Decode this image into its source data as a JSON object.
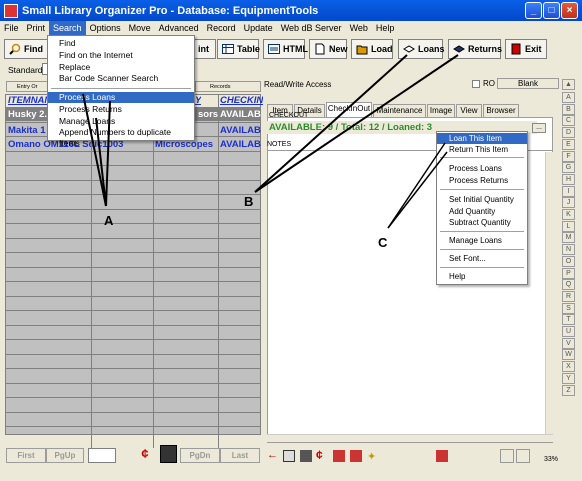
{
  "window": {
    "title": "Small Library Organizer Pro - Database: EquipmentTools"
  },
  "menubar": [
    "File",
    "Print",
    "Search",
    "Options",
    "Move",
    "Advanced",
    "Record",
    "Update",
    "Web dB Server",
    "Web",
    "Help"
  ],
  "toolbar": {
    "find": "Find",
    "print": "int",
    "table": "Table",
    "html": "HTML",
    "new": "New",
    "load": "Load",
    "loans": "Loans",
    "returns": "Returns",
    "exit": "Exit"
  },
  "standard_label": "Standard",
  "entry_order_label": "Entry Or",
  "records_label": "Records",
  "search_menu": {
    "items_group1": [
      "Find",
      "Find on the Internet",
      "Replace",
      "Bar Code Scanner Search"
    ],
    "items_group2": [
      "Process Loans",
      "Process Returns",
      "Manage Loans",
      "Append Numbers to duplicate Items"
    ]
  },
  "left_table": {
    "header": [
      "ITEMNAM",
      "Y",
      "CHECKIN"
    ],
    "rows": [
      {
        "name": "Husky 2.",
        "cat": "sors",
        "status": "AVAILAB"
      },
      {
        "name": "Makita 1",
        "cat": "",
        "status": "AVAILAB"
      },
      {
        "name": "Omano OM116L Sdic1003",
        "cat": "Microscopes",
        "status": "AVAILAB"
      }
    ]
  },
  "bottom_nav": {
    "first": "First",
    "pgup": "PgUp",
    "pgdn": "PgDn",
    "last": "Last"
  },
  "right": {
    "rw_label": "Read/Write Access",
    "ro_label": "RO",
    "blank_label": "Blank",
    "tabs": [
      "Item",
      "Details",
      "CheckInOut",
      "Maintenance",
      "Image",
      "View",
      "Browser"
    ],
    "active_tab": "CheckInOut",
    "checkout_label": "CHECKOUT",
    "status_text": "AVAILABLE: 9 / Total: 12 / Loaned: 3",
    "notes_label": "NOTES",
    "ellipsis": "..."
  },
  "context_menu": {
    "group1": [
      "Loan This Item",
      "Return This Item"
    ],
    "group2": [
      "Process Loans",
      "Process Returns"
    ],
    "group3": [
      "Set Initial Quantity",
      "Add Quantity",
      "Subtract Quantity"
    ],
    "group4": [
      "Manage Loans"
    ],
    "group5": [
      "Set Font..."
    ],
    "group6": [
      "Help"
    ]
  },
  "alphabet": [
    "A",
    "B",
    "C",
    "D",
    "E",
    "F",
    "G",
    "H",
    "I",
    "J",
    "K",
    "L",
    "M",
    "N",
    "O",
    "P",
    "Q",
    "R",
    "S",
    "T",
    "U",
    "V",
    "W",
    "X",
    "Y",
    "Z"
  ],
  "zoom": "33%",
  "callouts": {
    "a": "A",
    "b": "B",
    "c": "C"
  },
  "colors": {
    "title_blue": "#0348c8",
    "status_green": "#2a8f2a",
    "row_blue": "#1a2fd0",
    "highlight": "#316ac5"
  }
}
